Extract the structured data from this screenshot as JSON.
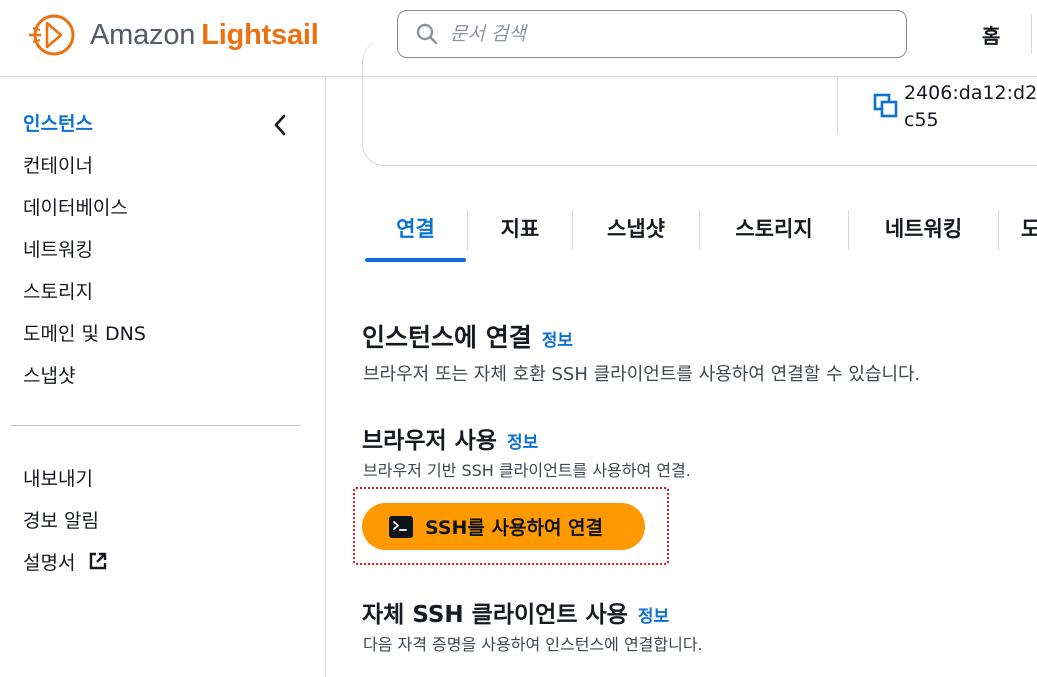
{
  "header": {
    "logo": {
      "amazon": "Amazon",
      "lightsail": "Lightsail"
    },
    "search": {
      "placeholder": "문서 검색"
    },
    "home_label": "홈"
  },
  "sidebar": {
    "items": [
      {
        "label": "인스턴스",
        "active": true
      },
      {
        "label": "컨테이너"
      },
      {
        "label": "데이터베이스"
      },
      {
        "label": "네트워킹"
      },
      {
        "label": "스토리지"
      },
      {
        "label": "도메인 및 DNS"
      },
      {
        "label": "스냅샷"
      }
    ],
    "secondary_items": [
      {
        "label": "내보내기"
      },
      {
        "label": "경보 알림"
      },
      {
        "label": "설명서"
      }
    ]
  },
  "instance_card": {
    "ipv6_line1": "2406:da12:d2",
    "ipv6_line2": "c55"
  },
  "tabs": [
    {
      "label": "연결",
      "active": true
    },
    {
      "label": "지표"
    },
    {
      "label": "스냅샷"
    },
    {
      "label": "스토리지"
    },
    {
      "label": "네트워킹"
    },
    {
      "label": "도"
    }
  ],
  "connect": {
    "title": "인스턴스에 연결",
    "info": "정보",
    "description": "브라우저 또는 자체 호환 SSH 클라이언트를 사용하여 연결할 수 있습니다.",
    "browser": {
      "title": "브라우저 사용",
      "info": "정보",
      "description": "브라우저 기반 SSH 클라이언트를 사용하여 연결.",
      "button_label": "SSH를 사용하여 연결"
    },
    "own_client": {
      "title": "자체 SSH 클라이언트 사용",
      "info": "정보",
      "description": "다음 자격 증명을 사용하여 인스턴스에 연결합니다."
    }
  },
  "colors": {
    "accent_blue": "#0972d3",
    "brand_orange": "#ec7211",
    "button_orange": "#ff9900",
    "highlight_red": "#d91515"
  }
}
